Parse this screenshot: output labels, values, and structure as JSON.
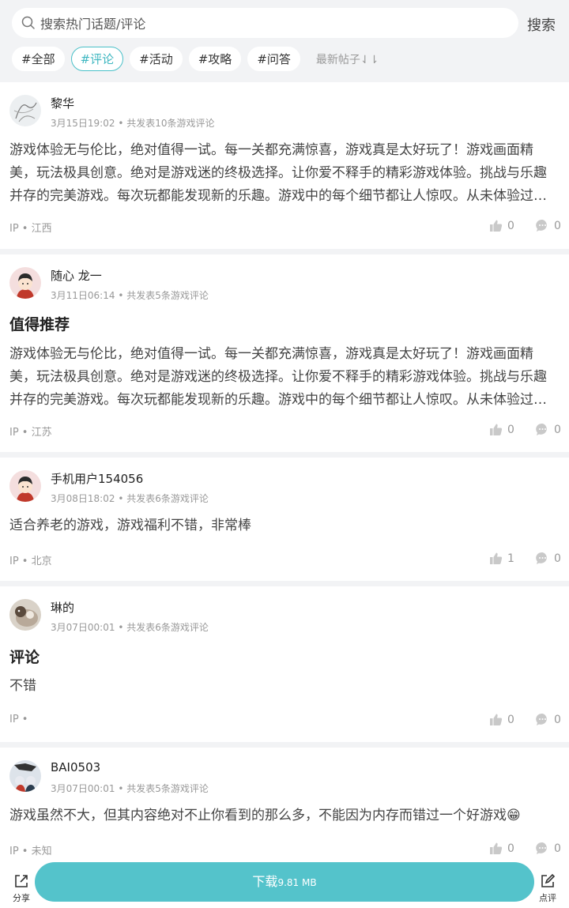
{
  "search": {
    "placeholder": "搜索热门话题/评论",
    "button": "搜索"
  },
  "tags": [
    "#全部",
    "#评论",
    "#活动",
    "#攻略",
    "#问答"
  ],
  "active_tag": "#评论",
  "sort_label": "最新帖子⇃⇂",
  "posts": [
    {
      "user": "黎华",
      "date": "3月15日19:02",
      "stat": "共发表10条游戏评论",
      "title": "",
      "body": "游戏体验无与伦比，绝对值得一试。每一关都充满惊喜，游戏真是太好玩了！游戏画面精美，玩法极具创意。绝对是游戏迷的终极选择。让你爱不释手的精彩游戏体验。挑战与乐趣并存的完美游戏。每次玩都能发现新的乐趣。游戏中的每个细节都让人惊叹。从未体验过如此精彩的游戏。",
      "ip": "IP • 江西",
      "likes": "0",
      "comments": "0"
    },
    {
      "user": "随心 龙一",
      "date": "3月11日06:14",
      "stat": "共发表5条游戏评论",
      "title": "值得推荐",
      "body": "游戏体验无与伦比，绝对值得一试。每一关都充满惊喜，游戏真是太好玩了！游戏画面精美，玩法极具创意。绝对是游戏迷的终极选择。让你爱不释手的精彩游戏体验。挑战与乐趣并存的完美游戏。每次玩都能发现新的乐趣。游戏中的每个细节都让人惊叹。从未体验过如此精彩的游戏。",
      "ip": "IP • 江苏",
      "likes": "0",
      "comments": "0"
    },
    {
      "user": "手机用户154056",
      "date": "3月08日18:02",
      "stat": "共发表6条游戏评论",
      "title": "",
      "body": "适合养老的游戏，游戏福利不错，非常棒",
      "ip": "IP • 北京",
      "likes": "1",
      "comments": "0"
    },
    {
      "user": "琳的",
      "date": "3月07日00:01",
      "stat": "共发表6条游戏评论",
      "title": "评论",
      "body": "不错",
      "ip": "IP •",
      "likes": "0",
      "comments": "0"
    },
    {
      "user": "BAI0503",
      "date": "3月07日00:01",
      "stat": "共发表5条游戏评论",
      "title": "",
      "body": "游戏虽然不大，但其内容绝对不止你看到的那么多，不能因为内存而错过一个好游戏😁",
      "ip": "IP • 未知",
      "likes": "0",
      "comments": "0"
    }
  ],
  "bottom": {
    "share": "分享",
    "download": "下载",
    "size": "9.81 MB",
    "review": "点评"
  },
  "accent": "#54c3cb"
}
